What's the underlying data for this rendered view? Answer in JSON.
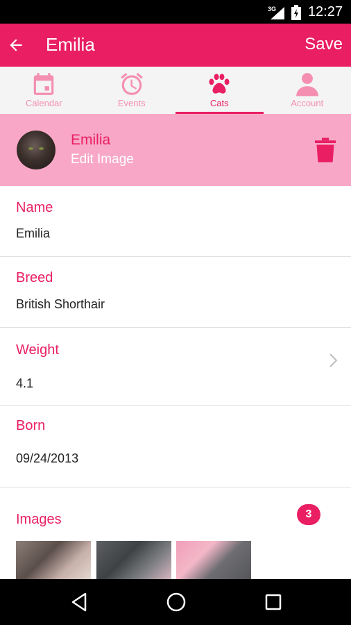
{
  "status_bar": {
    "network": "3G",
    "time": "12:27"
  },
  "app_bar": {
    "title": "Emilia",
    "save_label": "Save"
  },
  "tabs": [
    {
      "label": "Calendar",
      "icon": "calendar-icon"
    },
    {
      "label": "Events",
      "icon": "alarm-clock-icon"
    },
    {
      "label": "Cats",
      "icon": "paw-icon",
      "active": true
    },
    {
      "label": "Account",
      "icon": "person-icon"
    }
  ],
  "profile": {
    "name": "Emilia",
    "edit_label": "Edit Image"
  },
  "fields": {
    "name": {
      "label": "Name",
      "value": "Emilia"
    },
    "breed": {
      "label": "Breed",
      "value": "British Shorthair"
    },
    "weight": {
      "label": "Weight",
      "value": "4.1"
    },
    "born": {
      "label": "Born",
      "value": "09/24/2013"
    }
  },
  "images": {
    "label": "Images",
    "count": "3"
  },
  "colors": {
    "primary": "#e91e63",
    "banner": "#f8a8c6",
    "tab_inactive": "#f48fb1"
  }
}
